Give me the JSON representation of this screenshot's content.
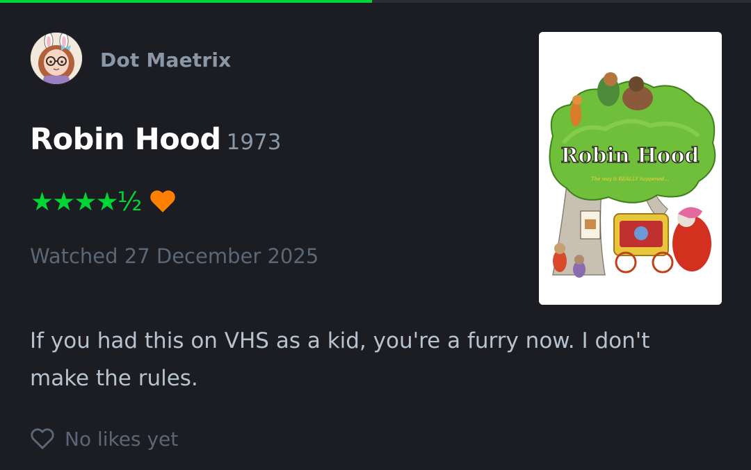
{
  "progress": {
    "fraction": 0.495,
    "fill_color": "#00d735"
  },
  "author": {
    "name": "Dot Maetrix",
    "avatar_icon": "user-avatar-icon"
  },
  "film": {
    "title": "Robin Hood",
    "year": "1973"
  },
  "rating": {
    "stars": "★★★★½",
    "value": 4.5,
    "liked": true,
    "star_color": "#00d735",
    "liked_color": "#ff8000"
  },
  "watched": {
    "text": "Watched 27 December 2025"
  },
  "review": {
    "text": "If you had this on VHS as a kid, you're a furry now. I don't make the rules."
  },
  "likes": {
    "text": "No likes yet",
    "icon": "heart-outline-icon"
  },
  "poster": {
    "title": "Robin Hood",
    "tagline": "The way it REALLY happened..."
  }
}
